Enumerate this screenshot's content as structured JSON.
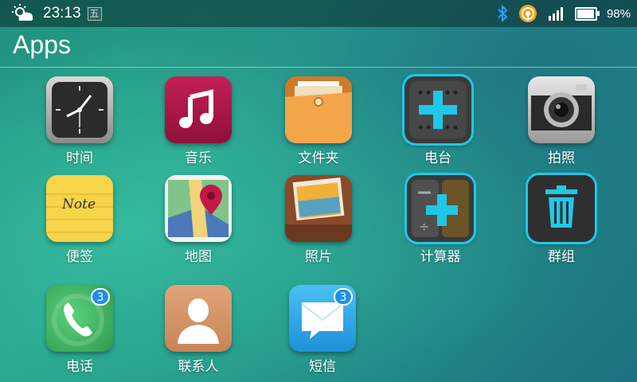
{
  "status_bar": {
    "time": "23:13",
    "day": "五",
    "battery_text": "98%",
    "battery_level": 0.98,
    "icons": [
      "weather-partly-cloudy-icon",
      "bluetooth-icon",
      "hotspot-icon",
      "signal-icon",
      "battery-icon"
    ]
  },
  "header": {
    "title": "Apps"
  },
  "apps": [
    {
      "label": "时间",
      "icon": "clock-icon"
    },
    {
      "label": "音乐",
      "icon": "music-icon"
    },
    {
      "label": "文件夹",
      "icon": "folder-icon"
    },
    {
      "label": "电台",
      "icon": "radio-icon"
    },
    {
      "label": "拍照",
      "icon": "camera-icon"
    },
    {
      "label": "便签",
      "icon": "note-icon",
      "icon_text": "Note"
    },
    {
      "label": "地图",
      "icon": "map-icon"
    },
    {
      "label": "照片",
      "icon": "photos-icon"
    },
    {
      "label": "计算器",
      "icon": "calculator-icon"
    },
    {
      "label": "群组",
      "icon": "trash-icon"
    },
    {
      "label": "电话",
      "icon": "phone-icon",
      "badge": "3"
    },
    {
      "label": "联系人",
      "icon": "contacts-icon"
    },
    {
      "label": "短信",
      "icon": "messages-icon",
      "badge": "3"
    }
  ],
  "colors": {
    "accent_cyan": "#20c8e8",
    "badge_blue": "#1e8ee8",
    "music_red": "#b0184a",
    "phone_green": "#3dbb5c",
    "contacts_tan": "#d99a6e",
    "messages_blue": "#2aa8e8"
  }
}
